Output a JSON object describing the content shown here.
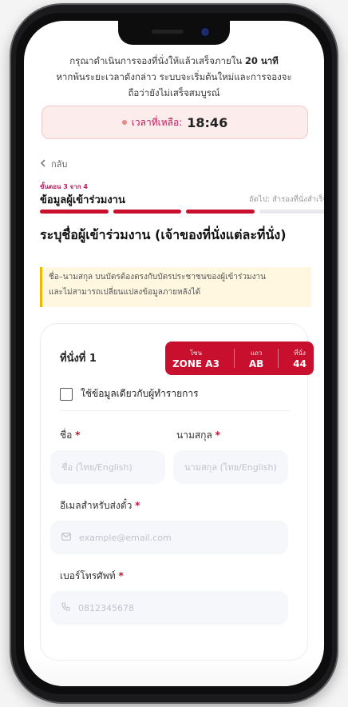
{
  "intro": {
    "line1_pre": "กรุณาดำเนินการจองที่นั่งให้แล้วเสร็จภายใน ",
    "line1_bold": "20 นาที",
    "line2": "หากพ้นระยะเวลาดังกล่าว ระบบจะเริ่มต้นใหม่และการจองจะ",
    "line3": "ถือว่ายังไม่เสร็จสมบูรณ์"
  },
  "timer": {
    "label": "เวลาที่เหลือ:",
    "value": "18:46"
  },
  "nav": {
    "back": "กลับ",
    "back_icon": "chevron-left"
  },
  "steps": {
    "counter": "ขั้นตอน 3 จาก 4",
    "current": "ข้อมูลผู้เข้าร่วมงาน",
    "next": "ถัดไป: สำรองที่นั่งสำเร็จ",
    "total": 4,
    "completed": 3
  },
  "heading": "ระบุชื่อผู้เข้าร่วมงาน (เจ้าของที่นั่งแต่ละที่นั่ง)",
  "notice": {
    "line1": "ชื่อ–นามสกุล บนบัตรต้องตรงกับบัตรประชาชนของผู้เข้าร่วมงาน",
    "line2": "และไม่สามารถเปลี่ยนแปลงข้อมูลภายหลังได้"
  },
  "seat": {
    "label": "ที่นั่งที่ 1",
    "zone_key": "โซน",
    "zone_val": "ZONE A3",
    "row_key": "แถว",
    "row_val": "AB",
    "seat_key": "ที่นั่ง",
    "seat_val": "44"
  },
  "same_as_buyer": "ใช้ข้อมูลเดียวกับผู้ทำรายการ",
  "fields": {
    "first_name": {
      "label": "ชื่อ",
      "placeholder": "ชื่อ (ไทย/English)"
    },
    "last_name": {
      "label": "นามสกุล",
      "placeholder": "นามสกุล (ไทย/English)"
    },
    "email": {
      "label": "อีเมลสำหรับส่งตั๋ว",
      "placeholder": "example@email.com",
      "icon": "mail"
    },
    "phone": {
      "label": "เบอร์โทรศัพท์",
      "placeholder": "0812345678",
      "icon": "phone"
    },
    "required_mark": "*"
  },
  "colors": {
    "accent": "#c8102e",
    "timer_bg": "#fdecec",
    "notice_bg": "#fff7e0"
  }
}
